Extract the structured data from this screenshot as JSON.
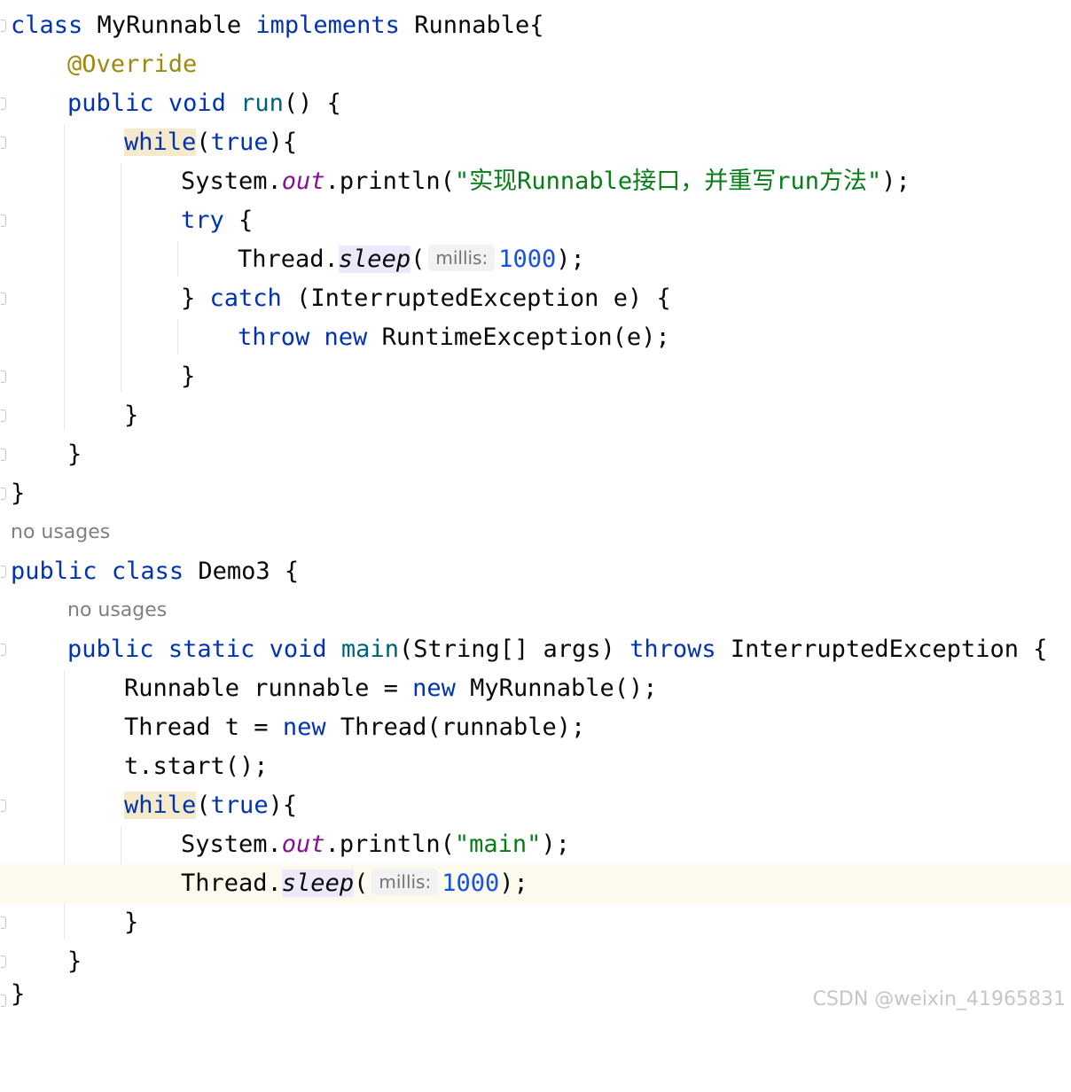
{
  "editor": {
    "language": "Java",
    "usage_hint": "no usages",
    "param_hint": "millis:",
    "colors": {
      "keyword": "#0033b3",
      "method": "#00627a",
      "annotation": "#9e880d",
      "string": "#067d17",
      "number": "#1750eb",
      "static_field": "#871094",
      "current_line": "#fcfaed"
    }
  },
  "code": {
    "l1": {
      "a": "class",
      "b": "MyRunnable",
      "c": "implements",
      "d": "Runnable{"
    },
    "l2": {
      "a": "@Override"
    },
    "l3": {
      "a": "public",
      "b": "void",
      "c": "run",
      "d": "() {"
    },
    "l4": {
      "a": "while",
      "b": "(",
      "c": "true",
      "d": "){"
    },
    "l5": {
      "a": "System.",
      "b": "out",
      "c": ".println(",
      "d": "\"实现Runnable接口，并重写run方法\"",
      "e": ");"
    },
    "l6": {
      "a": "try",
      "b": "{"
    },
    "l7": {
      "a": "Thread.",
      "b": "sleep",
      "c": "(",
      "d": "1000",
      "e": ");"
    },
    "l8": {
      "a": "}",
      "b": "catch",
      "c": "(InterruptedException e) {"
    },
    "l9": {
      "a": "throw",
      "b": "new",
      "c": "RuntimeException(e);"
    },
    "l10": {
      "a": "}"
    },
    "l11": {
      "a": "}"
    },
    "l12": {
      "a": "}"
    },
    "l13": {
      "a": "}"
    },
    "l14": {
      "a": "public",
      "b": "class",
      "c": "Demo3 {"
    },
    "l15": {
      "a": "public",
      "b": "static",
      "c": "void",
      "d": "main",
      "e": "(String[] args)",
      "f": "throws",
      "g": "InterruptedException {"
    },
    "l16": {
      "a": "Runnable runnable =",
      "b": "new",
      "c": "MyRunnable();"
    },
    "l17": {
      "a": "Thread t =",
      "b": "new",
      "c": "Thread(runnable);"
    },
    "l18": {
      "a": "t.start();"
    },
    "l19": {
      "a": "while",
      "b": "(",
      "c": "true",
      "d": "){"
    },
    "l20": {
      "a": "System.",
      "b": "out",
      "c": ".println(",
      "d": "\"main\"",
      "e": ");"
    },
    "l21": {
      "a": "Thread.",
      "b": "sleep",
      "c": "(",
      "d": "1000",
      "e": ");"
    },
    "l22": {
      "a": "}"
    },
    "l23": {
      "a": "}"
    },
    "l24": {
      "a": "}"
    }
  },
  "watermark": "CSDN @weixin_41965831"
}
